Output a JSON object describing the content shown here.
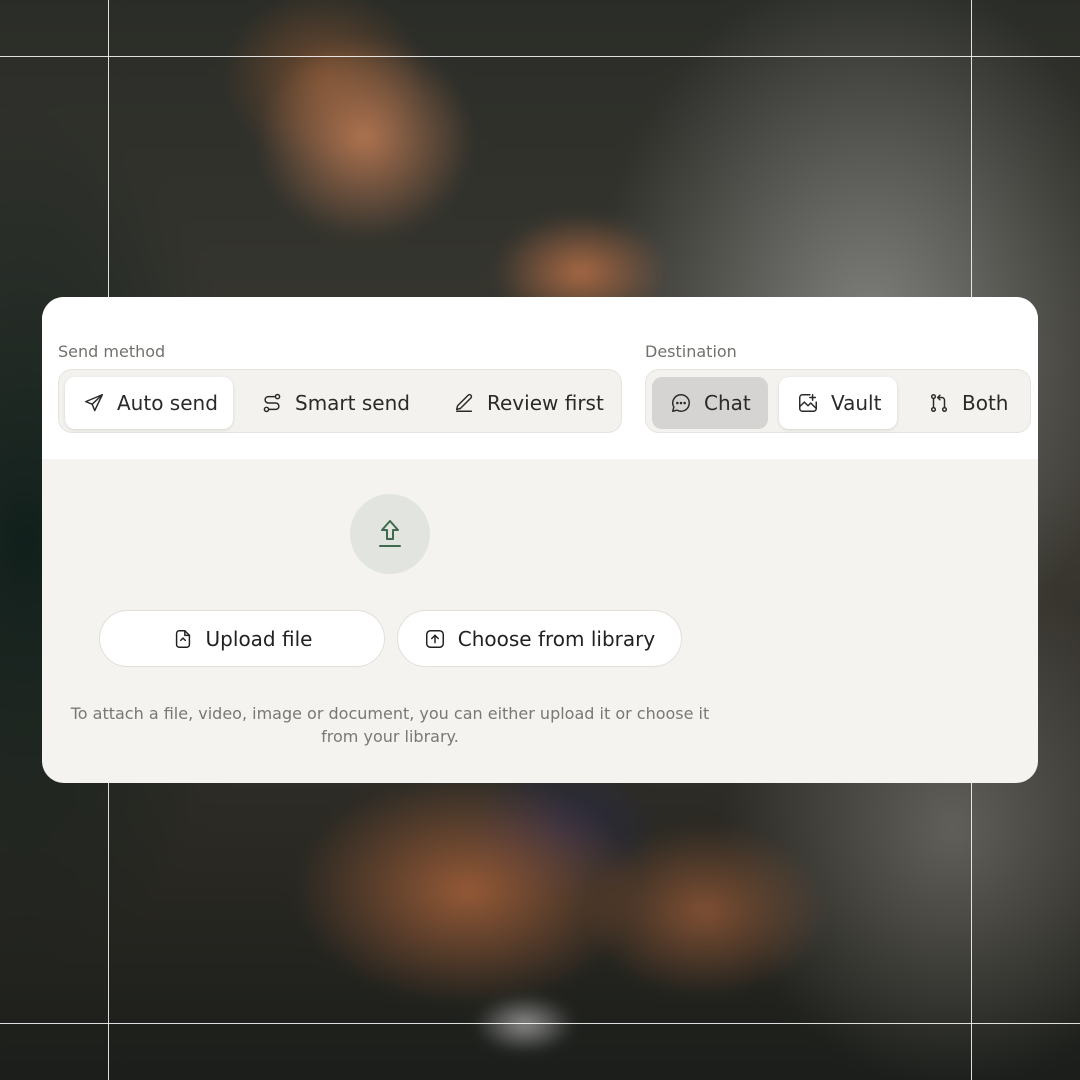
{
  "send_method": {
    "label": "Send method",
    "options": [
      {
        "label": "Auto send",
        "icon": "paper-plane-icon",
        "selected": true
      },
      {
        "label": "Smart send",
        "icon": "route-icon",
        "selected": false
      },
      {
        "label": "Review first",
        "icon": "pencil-icon",
        "selected": false
      }
    ]
  },
  "destination": {
    "label": "Destination",
    "options": [
      {
        "label": "Chat",
        "icon": "chat-bubble-icon",
        "state": "active"
      },
      {
        "label": "Vault",
        "icon": "image-vault-icon",
        "state": "selected"
      },
      {
        "label": "Both",
        "icon": "merge-icon",
        "state": "none"
      }
    ]
  },
  "upload": {
    "icon": "upload-arrow-icon",
    "upload_file_label": "Upload file",
    "choose_library_label": "Choose from library",
    "help_text": "To attach a file, video, image or document, you can either upload it or choose it from your library."
  },
  "colors": {
    "card_background": "#f5f3ef",
    "accent_green": "#3f6b4c",
    "active_chip": "#d6d4d3"
  }
}
